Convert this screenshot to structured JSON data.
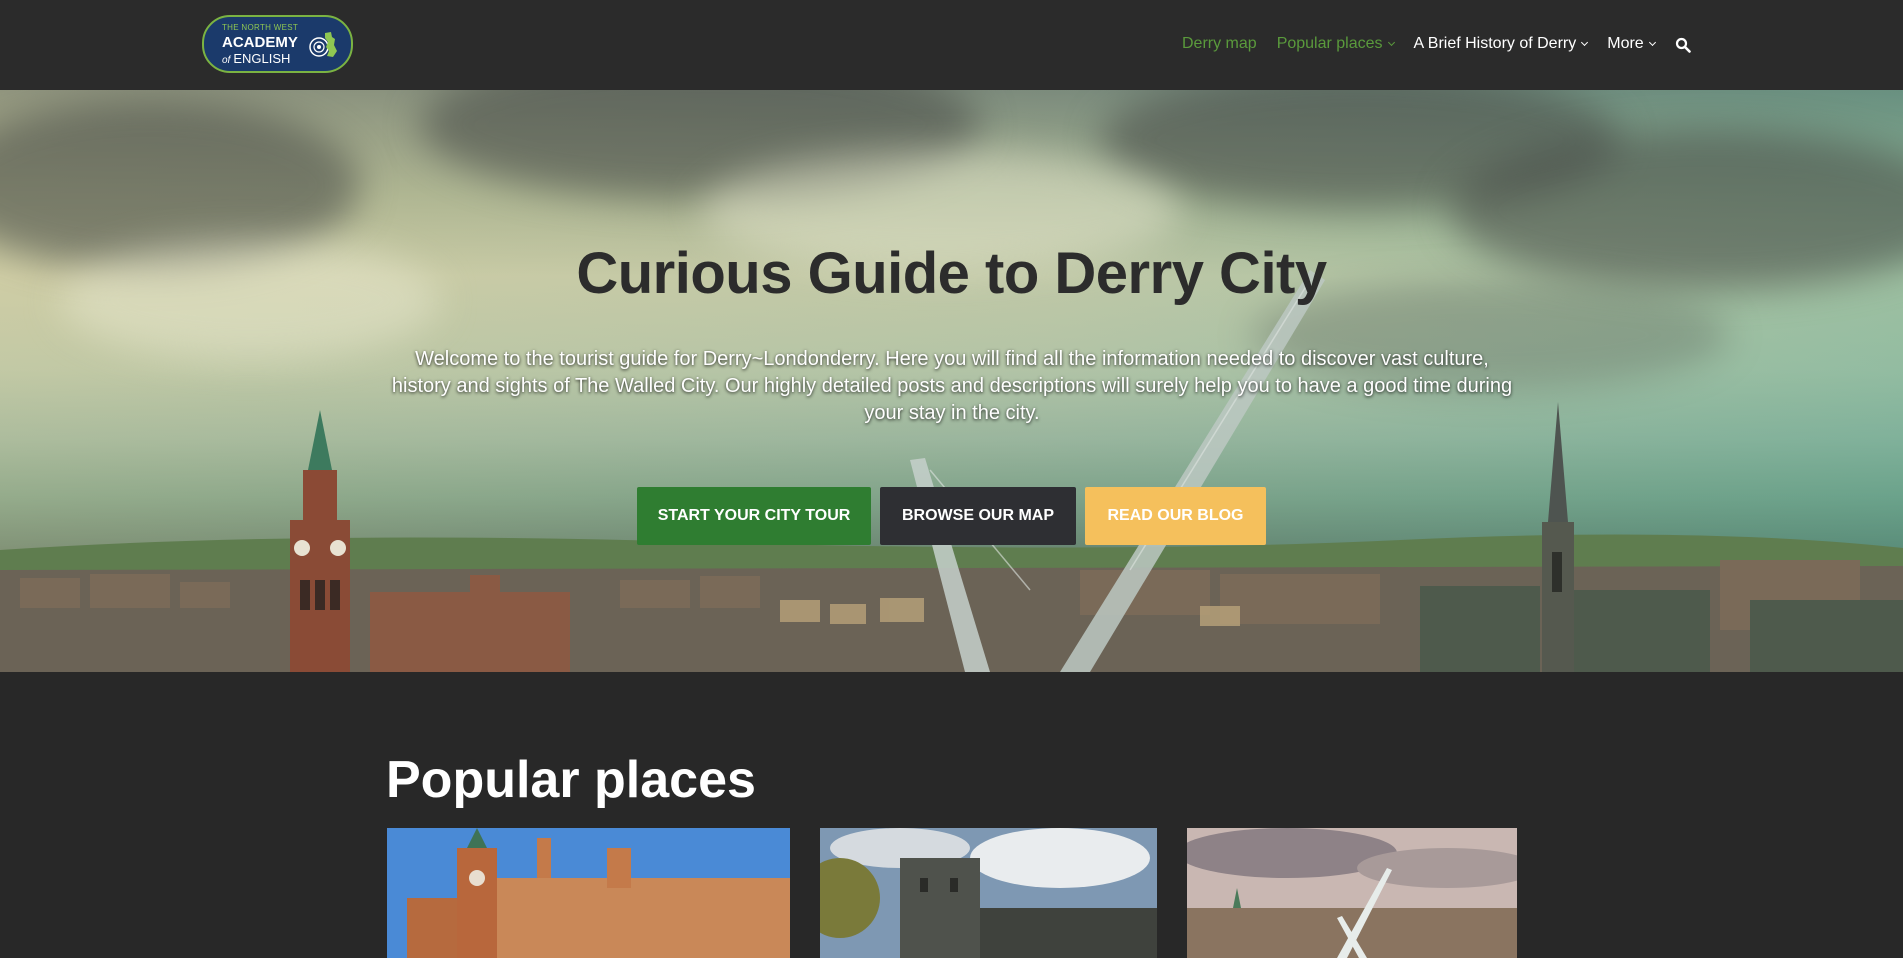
{
  "header": {
    "logo": {
      "line1": "THE NORTH WEST",
      "line2": "ACADEMY",
      "line3_prefix": "of",
      "line3": "ENGLISH"
    },
    "nav": [
      {
        "label": "Derry map",
        "has_dropdown": false,
        "color": "#5a9a3c"
      },
      {
        "label": "Popular places",
        "has_dropdown": true,
        "color": "#5a9a3c"
      },
      {
        "label": "A Brief History of Derry",
        "has_dropdown": true,
        "color": "#ffffff"
      },
      {
        "label": "More",
        "has_dropdown": true,
        "color": "#ffffff"
      }
    ],
    "search_icon": "search-icon"
  },
  "hero": {
    "title": "Curious Guide to Derry City",
    "text": "Welcome to the tourist guide for Derry~Londonderry. Here you will find all the information needed to discover vast culture, history and sights of The Walled City. Our highly detailed posts and descriptions will surely help you to have a good time during your stay in the city.",
    "buttons": [
      {
        "label": "START YOUR CITY TOUR",
        "color": "#2f7d31"
      },
      {
        "label": "BROWSE OUR MAP",
        "color": "#2e2f33"
      },
      {
        "label": "READ OUR BLOG",
        "color": "#f5c05c"
      }
    ]
  },
  "popular": {
    "title": "Popular places",
    "cards": [
      {
        "image": "guildhall-photo"
      },
      {
        "image": "castle-tower-photo"
      },
      {
        "image": "peace-bridge-photo"
      }
    ]
  },
  "colors": {
    "background": "#282828",
    "header": "#2b2b2b",
    "accent_green": "#5a9a3c"
  }
}
